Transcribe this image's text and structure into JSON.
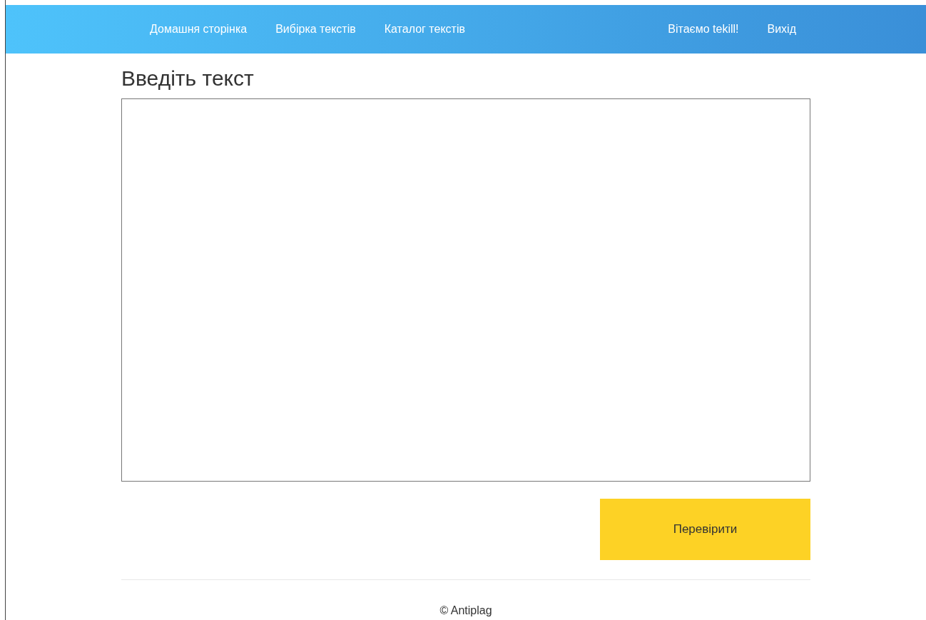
{
  "navbar": {
    "links": [
      {
        "label": "Домашня сторінка"
      },
      {
        "label": "Вибірка текстів"
      },
      {
        "label": "Каталог текстів"
      }
    ],
    "greeting": "Вітаємо tekill!",
    "logout": "Вихід"
  },
  "form": {
    "heading": "Введіть текст",
    "submit": "Перевірити"
  },
  "footer": "© Antiplag"
}
